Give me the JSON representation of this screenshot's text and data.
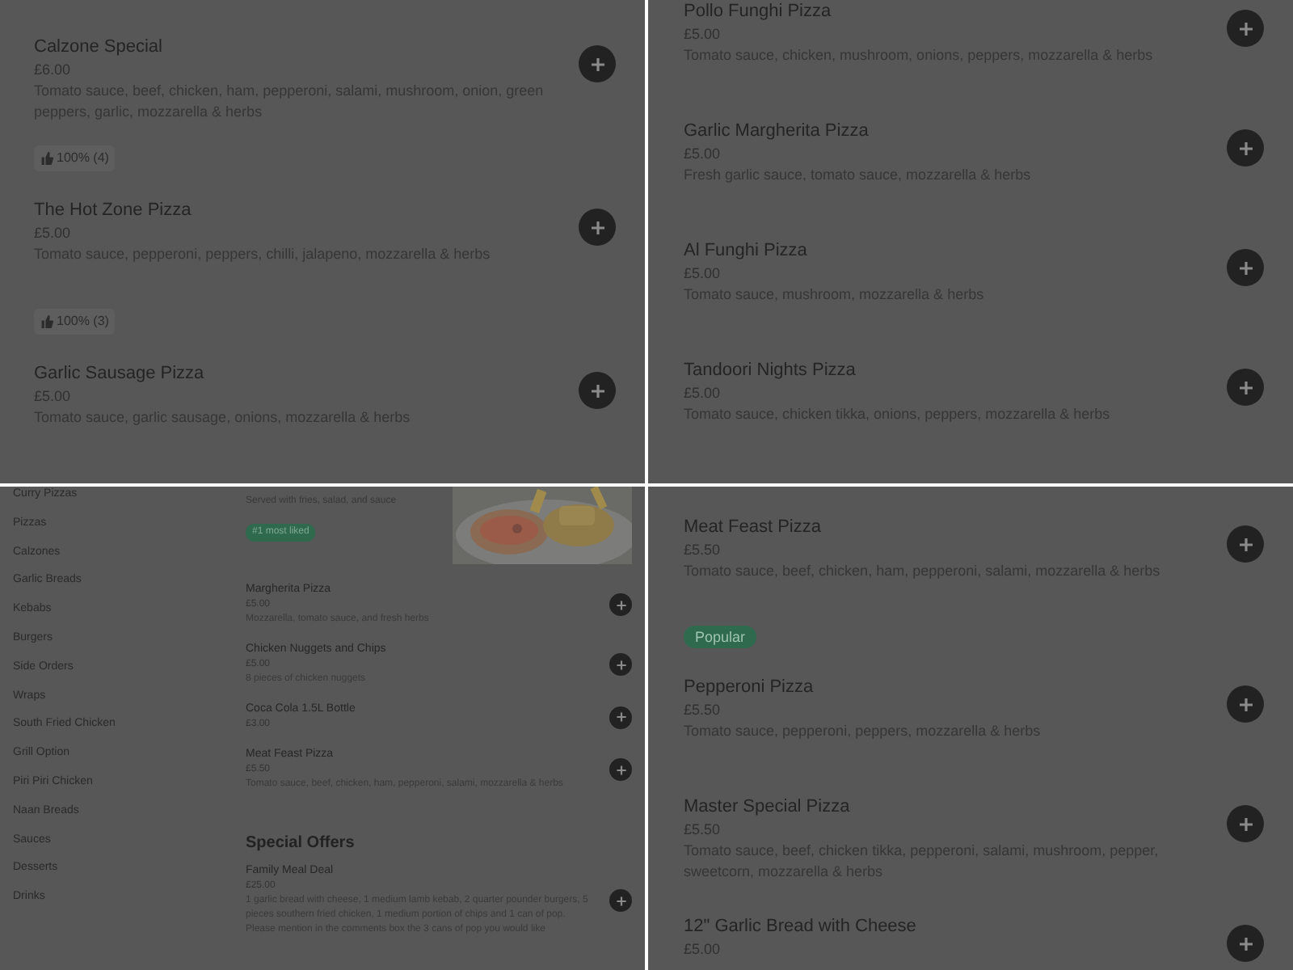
{
  "panels": [
    {
      "kind": "menu",
      "items": [
        {
          "name": "Calzone Special",
          "price": "£6.00",
          "description": "Tomato sauce, beef, chicken, ham, pepperoni, salami, mushroom, onion, green peppers, garlic, mozzarella & herbs"
        },
        {
          "name": "The Hot Zone Pizza",
          "price": "£5.00",
          "description": "Tomato sauce, pepperoni, peppers, chilli, jalapeno, mozzarella & herbs",
          "badge": {
            "kind": "rating",
            "text": "100% (4)"
          }
        },
        {
          "name": "Garlic Sausage Pizza",
          "price": "£5.00",
          "description": "Tomato sauce, garlic sausage, onions, mozzarella & herbs",
          "badge": {
            "kind": "rating",
            "text": "100% (3)"
          }
        }
      ]
    },
    {
      "kind": "menu",
      "items": [
        {
          "name": "Pollo Funghi Pizza",
          "price": "£5.00",
          "description": "Tomato sauce, chicken, mushroom, onions, peppers, mozzarella & herbs"
        },
        {
          "name": "Garlic Margherita Pizza",
          "price": "£5.00",
          "description": "Fresh garlic sauce, tomato sauce, mozzarella & herbs"
        },
        {
          "name": "Al Funghi Pizza",
          "price": "£5.00",
          "description": "Tomato sauce, mushroom, mozzarella & herbs"
        },
        {
          "name": "Tandoori Nights Pizza",
          "price": "£5.00",
          "description": "Tomato sauce, chicken tikka, onions, peppers, mozzarella & herbs"
        }
      ]
    },
    {
      "kind": "store",
      "categories": [
        "Curry Pizzas",
        "Pizzas",
        "Calzones",
        "Garlic Breads",
        "Kebabs",
        "Burgers",
        "Side Orders",
        "Wraps",
        "South Fried Chicken",
        "Grill Option",
        "Piri Piri Chicken",
        "Naan Breads",
        "Sauces",
        "Desserts",
        "Drinks"
      ],
      "top_item": {
        "description": "Served with fries, salad, and sauce",
        "badge": "#1 most liked"
      },
      "items": [
        {
          "name": "Margherita Pizza",
          "price": "£5.00",
          "description": "Mozzarella, tomato sauce, and fresh herbs"
        },
        {
          "name": "Chicken Nuggets and Chips",
          "price": "£5.00",
          "description": "8 pieces of chicken nuggets"
        },
        {
          "name": "Coca Cola 1.5L Bottle",
          "price": "£3.00"
        },
        {
          "name": "Meat Feast Pizza",
          "price": "£5.50",
          "description": "Tomato sauce, beef, chicken, ham, pepperoni, salami, mozzarella & herbs"
        }
      ],
      "section": {
        "title": "Special Offers",
        "items": [
          {
            "name": "Family Meal Deal",
            "price": "£25.00",
            "description": "1 garlic bread with cheese, 1 medium lamb kebab, 2 quarter pounder burgers, 5 pieces southern fried chicken, 1 medium portion of chips and 1 can of pop. Please mention in the comments box the 3 cans of pop you would like"
          }
        ]
      }
    },
    {
      "kind": "menu",
      "items": [
        {
          "name": "Meat Feast Pizza",
          "price": "£5.50",
          "description": "Tomato sauce, beef, chicken, ham, pepperoni, salami, mozzarella & herbs"
        },
        {
          "name": "Pepperoni Pizza",
          "price": "£5.50",
          "description": "Tomato sauce, pepperoni, peppers, mozzarella & herbs",
          "badge": {
            "kind": "tag",
            "text": "Popular"
          }
        },
        {
          "name": "Master Special Pizza",
          "price": "£5.50",
          "description": "Tomato sauce, beef, chicken tikka, pepperoni, salami, mushroom, pepper, sweetcorn, mozzarella & herbs"
        },
        {
          "name": "12\" Garlic Bread with Cheese",
          "price": "£5.00"
        }
      ]
    }
  ]
}
